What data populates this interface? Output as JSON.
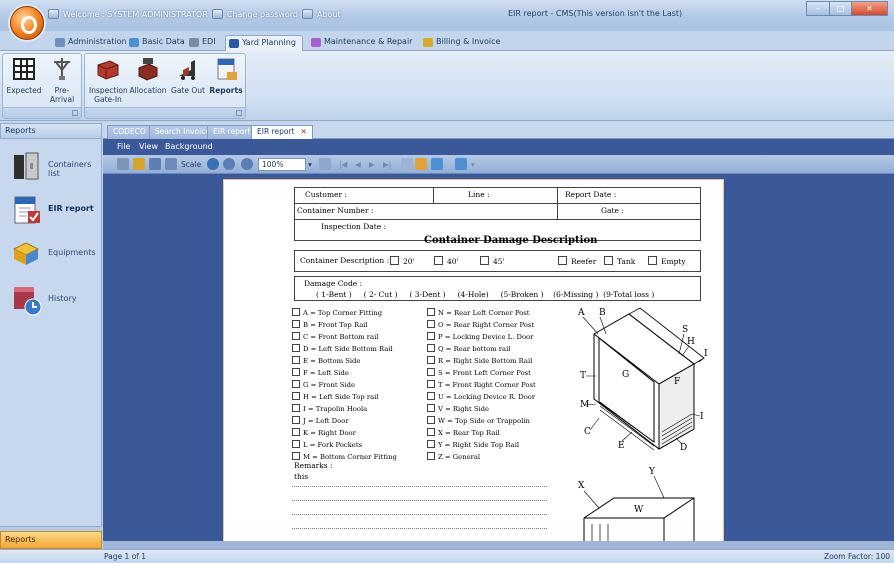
{
  "titlebar": {
    "welcome": "Welcome : SYSTEM ADMINISTRATOR",
    "change_password": "Change password",
    "about": "About",
    "window_title": "EIR report - CMS(This version isn't the Last)"
  },
  "ribbon": {
    "tabs": [
      {
        "label": "Administration",
        "color": "#6f8fbd"
      },
      {
        "label": "Basic Data",
        "color": "#4d8fd0"
      },
      {
        "label": "EDI",
        "color": "#7a8c9f"
      },
      {
        "label": "Yard Planning",
        "color": "#2a5aa4"
      },
      {
        "label": "Maintenance & Repair",
        "color": "#a85fd0"
      },
      {
        "label": "Billing & Invoice",
        "color": "#d7a92a"
      }
    ],
    "buttons": [
      {
        "label": "Expected"
      },
      {
        "label": "Pre-Arrival"
      },
      {
        "label": "Inspection Gate-In"
      },
      {
        "label": "Allocation"
      },
      {
        "label": "Gate Out"
      },
      {
        "label": "Reports"
      }
    ]
  },
  "nav": {
    "header": "Reports",
    "items": [
      {
        "label": "Containers list",
        "icon": "gate-icon"
      },
      {
        "label": "EIR report",
        "icon": "report-check-icon"
      },
      {
        "label": "Equipments",
        "icon": "equipment-icon"
      },
      {
        "label": "History",
        "icon": "history-icon"
      }
    ],
    "footer": "Reports"
  },
  "doc_tabs": [
    {
      "label": "CODECO"
    },
    {
      "label": "Search Invoice"
    },
    {
      "label": "EIR report"
    },
    {
      "label": "EIR report"
    }
  ],
  "report_menu": [
    "File",
    "View",
    "Background"
  ],
  "toolbar": {
    "scale_label": "Scale",
    "zoom": "100%"
  },
  "report": {
    "customer": "Customer :",
    "line": "Line :",
    "report_date": "Report Date :",
    "container_number": "Container Number :",
    "gate": "Gate :",
    "inspection_date": "Inspection Date :",
    "title": "Container Damage Description",
    "container_description_label": "Container Description :",
    "sizes": [
      "20'",
      "40'",
      "45'"
    ],
    "types": [
      "Reefer",
      "Tank",
      "Empty"
    ],
    "damage_code_label": "Damage Code :",
    "damage_codes": "( 1-Bent )     ( 2- Cut )     ( 3-Dent )     (4-Hole)     (5-Broken )    (6-Missing )  (9-Total loss )",
    "left_codes": [
      "A = Top Corner Fitting",
      "B = Front Top Rail",
      "C = Front Bottom rail",
      "D = Left Side Bottom Rail",
      "E = Bottom Side",
      "F = Left Side",
      "G = Front Side",
      "H = Left Side Top rail",
      "I = Trapolin Hoola",
      "J = Left Door",
      "K = Right Door",
      "L = Fork Pockets",
      "M = Bottom Corner Fitting"
    ],
    "right_codes": [
      "N = Rear Left Corner Post",
      "O = Rear Right Corner Post",
      "P = Locking Device L. Door",
      "Q = Rear bottom rail",
      "R = Right Side Bottom Rail",
      "S = Front Left Corner Post",
      "T = Front Right Corner Post",
      "U = Locking Device R. Door",
      "V = Right Side",
      "W = Top Side or Trappolin",
      "X = Rear Top Rail",
      "Y = Right Side Top Rail",
      "Z = General"
    ],
    "diagram_labels": [
      "A",
      "B",
      "S",
      "H",
      "I",
      "G",
      "F",
      "T",
      "M",
      "C",
      "E",
      "I",
      "D"
    ],
    "diagram2_labels": [
      "X",
      "Y",
      "W"
    ],
    "remarks_label": "Remarks :",
    "remarks_value": "this"
  },
  "status": {
    "page": "Page 1 of 1",
    "zoom_factor": "Zoom Factor: 100"
  }
}
